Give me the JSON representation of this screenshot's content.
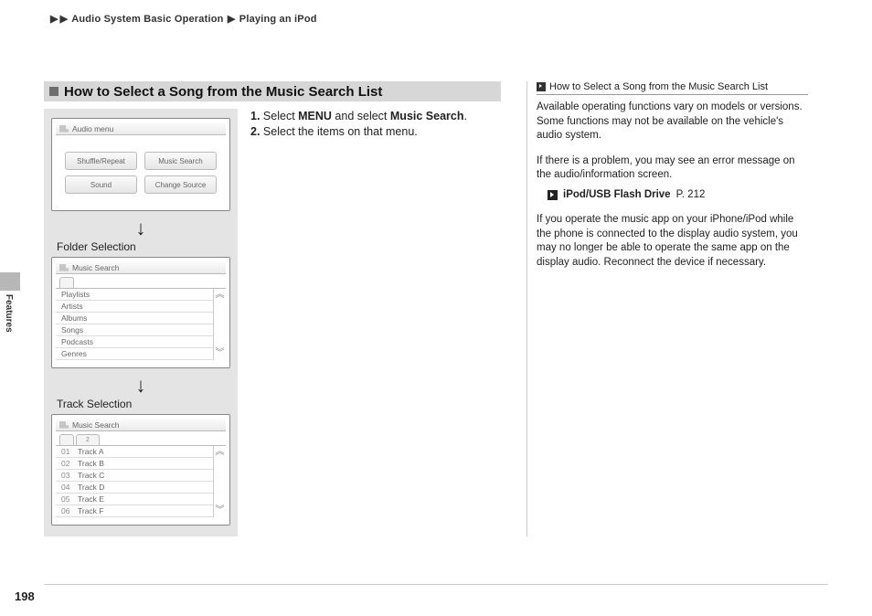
{
  "breadcrumb": {
    "sep": "▶",
    "part1": "Audio System Basic Operation",
    "part2": "Playing an iPod"
  },
  "section": {
    "title": "How to Select a Song from the Music Search List"
  },
  "instructions": {
    "step1_num": "1.",
    "step1_a": "Select ",
    "step1_b": "MENU",
    "step1_c": " and select ",
    "step1_d": "Music Search",
    "step1_e": ".",
    "step2_num": "2.",
    "step2": "Select the items on that menu."
  },
  "screens": {
    "audio_menu": {
      "header": "Audio menu",
      "buttons": [
        "Shuffle/Repeat",
        "Music Search",
        "Sound",
        "Change Source"
      ]
    },
    "folder_label": "Folder Selection",
    "music_search": {
      "header": "Music Search",
      "items": [
        "Playlists",
        "Artists",
        "Albums",
        "Songs",
        "Podcasts",
        "Genres"
      ]
    },
    "track_label": "Track Selection",
    "track_list": {
      "header": "Music Search",
      "tab2": "2",
      "tracks": [
        {
          "idx": "01",
          "name": "Track A"
        },
        {
          "idx": "02",
          "name": "Track B"
        },
        {
          "idx": "03",
          "name": "Track C"
        },
        {
          "idx": "04",
          "name": "Track D"
        },
        {
          "idx": "05",
          "name": "Track E"
        },
        {
          "idx": "06",
          "name": "Track F"
        }
      ]
    },
    "arrow": "↓"
  },
  "sidebar": {
    "title": "How to Select a Song from the Music Search List",
    "p1": "Available operating functions vary on models or versions. Some functions may not be available on the vehicle's audio system.",
    "p2": "If there is a problem, you may see an error message on the audio/information screen.",
    "xref_label": "iPod/USB Flash Drive",
    "xref_page": "P. 212",
    "p3": "If you operate the music app on your iPhone/iPod while the phone is connected to the display audio system, you may no longer be able to operate the same app on the display audio. Reconnect the device if necessary."
  },
  "side_tab": {
    "label": "Features"
  },
  "page_number": "198"
}
